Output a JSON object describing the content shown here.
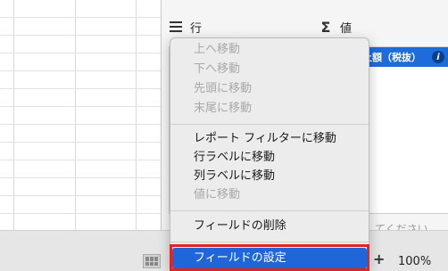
{
  "panel": {
    "rows_header": "行",
    "values_header": "値",
    "value_field": "上額（税抜）",
    "value_info_icon": "info-icon",
    "drop_hint": "てください"
  },
  "status_bar": {
    "zoom_plus": "+",
    "zoom_level": "100%"
  },
  "context_menu": {
    "move_group": [
      {
        "label": "上へ移動",
        "enabled": false
      },
      {
        "label": "下へ移動",
        "enabled": false
      },
      {
        "label": "先頭に移動",
        "enabled": false
      },
      {
        "label": "末尾に移動",
        "enabled": false
      }
    ],
    "area_group": [
      {
        "label": "レポート フィルターに移動",
        "enabled": true
      },
      {
        "label": "行ラベルに移動",
        "enabled": true
      },
      {
        "label": "列ラベルに移動",
        "enabled": true
      },
      {
        "label": "値に移動",
        "enabled": false
      }
    ],
    "delete_field": "フィールドの削除",
    "field_settings": "フィールドの設定"
  },
  "colors": {
    "accent": "#1f66d8",
    "highlight_outline": "#e02424"
  }
}
